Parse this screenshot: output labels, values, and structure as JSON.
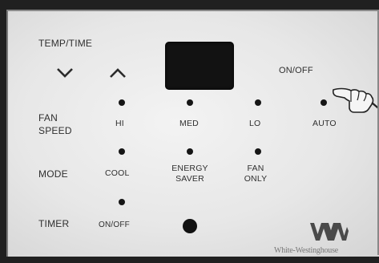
{
  "labels": {
    "temp_time": "TEMP/TIME",
    "on_off": "ON/OFF",
    "fan_speed_line1": "FAN",
    "fan_speed_line2": "SPEED",
    "hi": "HI",
    "med": "MED",
    "lo": "LO",
    "auto": "AUTO",
    "mode": "MODE",
    "cool": "COOL",
    "energy_saver_line1": "ENERGY",
    "energy_saver_line2": "SAVER",
    "fan_only_line1": "FAN",
    "fan_only_line2": "ONLY",
    "timer": "TIMER",
    "timer_on_off": "ON/OFF"
  },
  "brand": {
    "name": "White-Westinghouse",
    "logo_color": "#4a4a4a"
  },
  "icons": {
    "down": "chevron-down-icon",
    "up": "chevron-up-icon",
    "pointer": "pointing-hand-icon"
  },
  "colors": {
    "panel": "#ececec",
    "display": "#121212",
    "led": "#151515",
    "text": "#2f2f2f"
  }
}
